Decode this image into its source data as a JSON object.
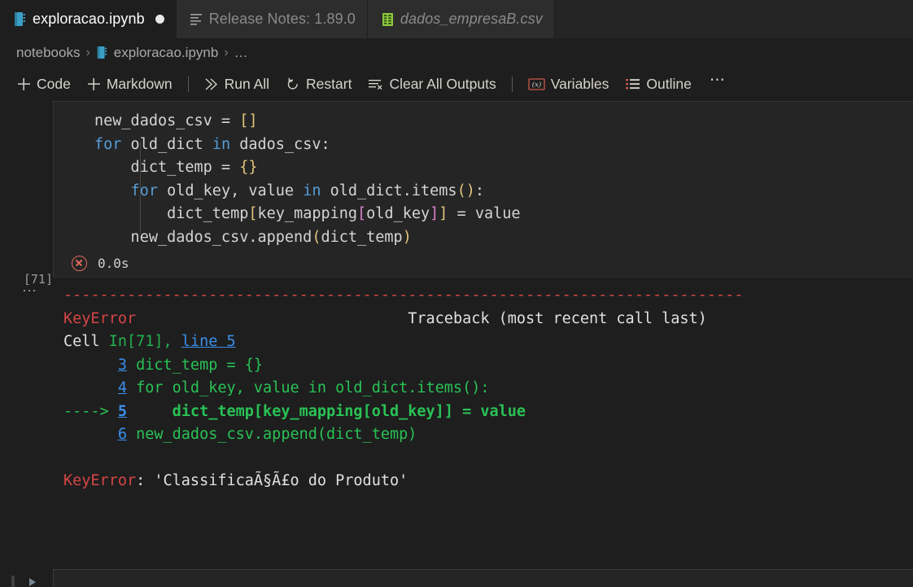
{
  "tabs": [
    {
      "label": "exploracao.ipynb",
      "icon": "notebook-icon",
      "active": true,
      "dirty": true,
      "preview": false
    },
    {
      "label": "Release Notes: 1.89.0",
      "icon": "release-notes-icon",
      "active": false,
      "dirty": false,
      "preview": false
    },
    {
      "label": "dados_empresaB.csv",
      "icon": "csv-file-icon",
      "active": false,
      "dirty": false,
      "preview": true
    }
  ],
  "breadcrumb": {
    "folder": "notebooks",
    "sep1": "›",
    "file": "exploracao.ipynb",
    "sep2": "›",
    "more": "…"
  },
  "toolbar": {
    "add_code": "Code",
    "add_markdown": "Markdown",
    "run_all": "Run All",
    "restart": "Restart",
    "clear_all_outputs": "Clear All Outputs",
    "variables": "Variables",
    "variables_icon_label": "(x)",
    "outline": "Outline",
    "more": "⋯"
  },
  "cell": {
    "execution_count": "[71]",
    "elapsed": "0.0s",
    "status_icon": "error-circle-x-icon",
    "source_lines": [
      "new_dados_csv = []",
      "for old_dict in dados_csv:",
      "    dict_temp = {}",
      "    for old_key, value in old_dict.items():",
      "        dict_temp[key_mapping[old_key]] = value",
      "    new_dados_csv.append(dict_temp)"
    ]
  },
  "output": {
    "more_actions": "⋯",
    "divider": "---------------------------------------------------------------------------",
    "error_type": "KeyError",
    "traceback_header": "Traceback (most recent call last)",
    "cell_word": "Cell ",
    "cell_ref": "In[71],",
    "line_link": "line 5",
    "frames": [
      {
        "arrow": "",
        "num": "3",
        "code": "dict_temp = {}",
        "highlight": false
      },
      {
        "arrow": "",
        "num": "4",
        "code": "for old_key, value in old_dict.items():",
        "highlight": false
      },
      {
        "arrow": "---->",
        "num": "5",
        "code": "    dict_temp[key_mapping[old_key]] = value",
        "highlight": true
      },
      {
        "arrow": "",
        "num": "6",
        "code": "new_dados_csv.append(dict_temp)",
        "highlight": false
      }
    ],
    "final_error_type": "KeyError",
    "final_error_message": ": 'ClassificaÃ§Ã£o do Produto'"
  },
  "colors": {
    "background": "#1e1e1e",
    "editor_background": "#252526",
    "tab_inactive": "#2d2d2d",
    "error_red": "#d64545",
    "traceback_green": "#23b14d",
    "link_blue": "#3b8eea",
    "keyword_blue": "#569cd6",
    "bracket_yellow": "#e3c57a",
    "bracket_magenta": "#d682c8",
    "error_icon": "#e06c5a"
  }
}
